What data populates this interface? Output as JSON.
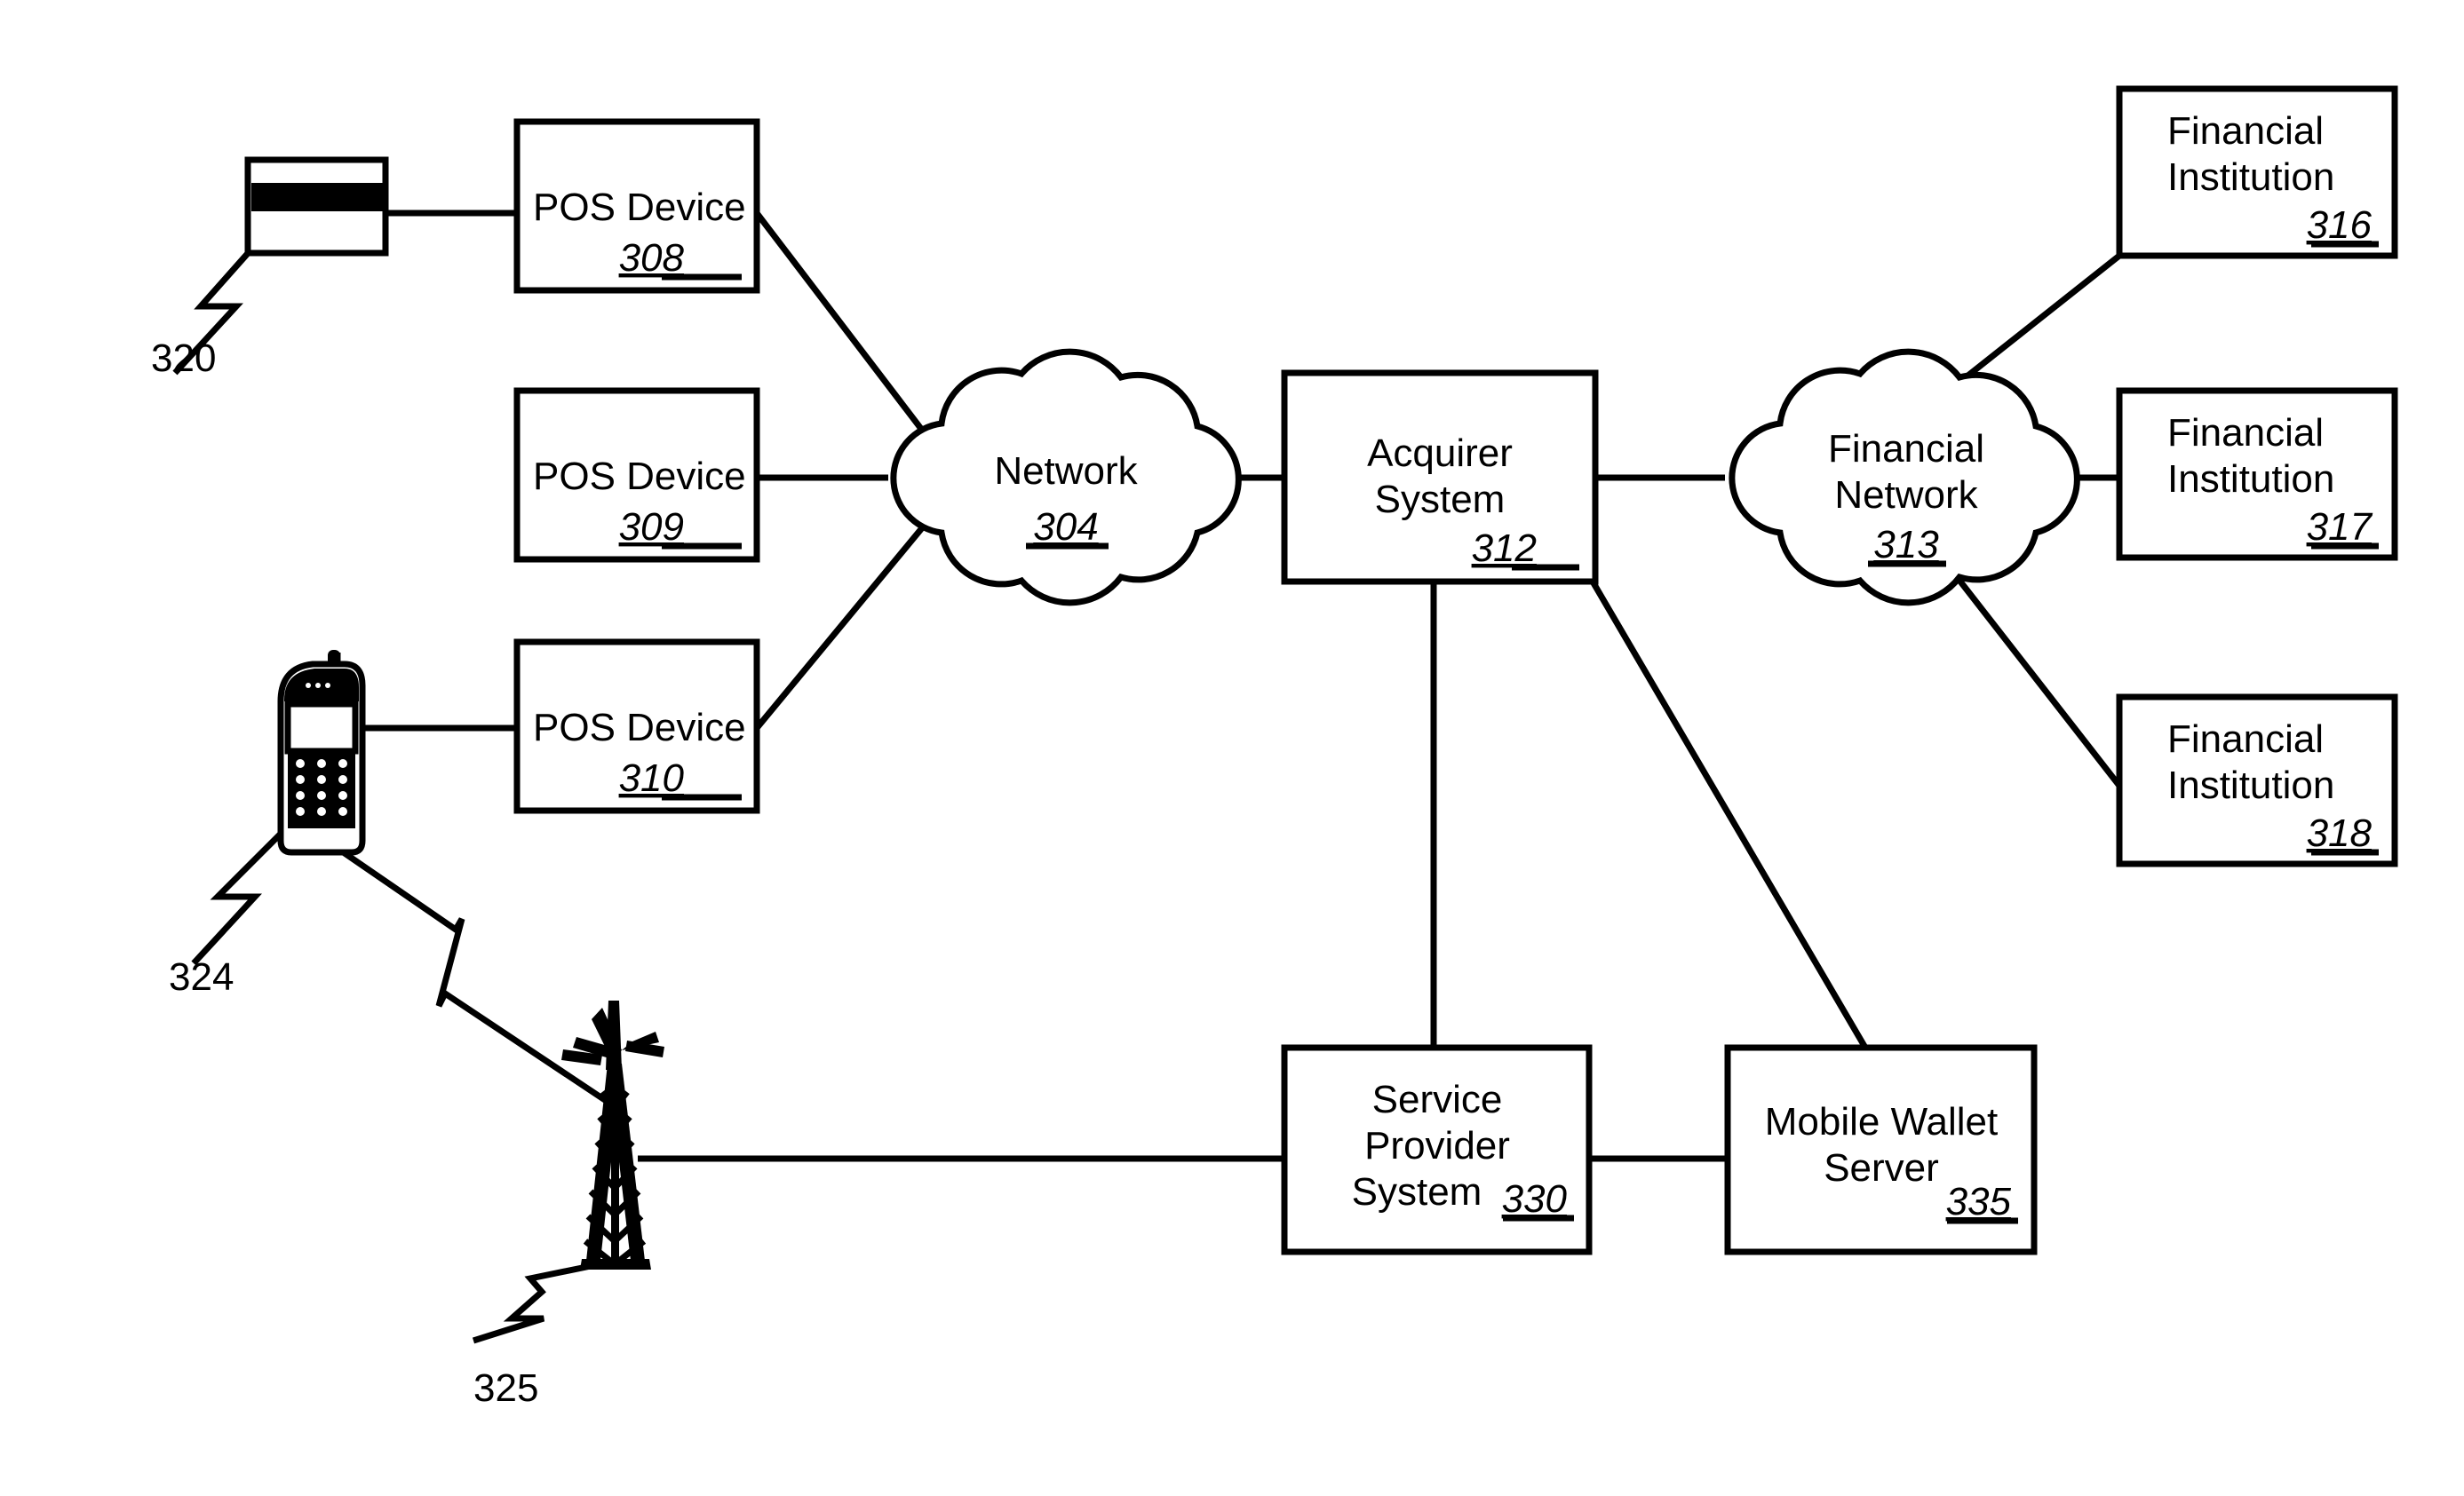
{
  "figure": {
    "title": "Payment Transaction System Block Diagram",
    "background_color": "#ffffff",
    "line_color": "#000000"
  },
  "nodes": {
    "pos_308": {
      "label": "POS Device",
      "ref": "308"
    },
    "pos_309": {
      "label": "POS Device",
      "ref": "309"
    },
    "pos_310": {
      "label": "POS Device",
      "ref": "310"
    },
    "network_304": {
      "label": "Network",
      "ref": "304"
    },
    "acquirer_312": {
      "label_line1": "Acquirer",
      "label_line2": "System",
      "ref": "312"
    },
    "financial_network_313": {
      "label_line1": "Financial",
      "label_line2": "Network",
      "ref": "313"
    },
    "fi_316": {
      "label_line1": "Financial",
      "label_line2": "Institution",
      "ref": "316"
    },
    "fi_317": {
      "label_line1": "Financial",
      "label_line2": "Institution",
      "ref": "317"
    },
    "fi_318": {
      "label_line1": "Financial",
      "label_line2": "Institution",
      "ref": "318"
    },
    "service_provider_330": {
      "label_line1": "Service",
      "label_line2": "Provider",
      "label_line3": "System",
      "ref": "330"
    },
    "mobile_wallet_335": {
      "label_line1": "Mobile Wallet",
      "label_line2": "Server",
      "ref": "335"
    }
  },
  "icons": {
    "payment_card": {
      "name": "payment-card-icon",
      "ref": "320"
    },
    "mobile_phone": {
      "name": "mobile-phone-icon",
      "ref": "324"
    },
    "cell_tower": {
      "name": "cell-tower-icon",
      "ref": "325"
    }
  },
  "reference_labels": {
    "card": "320",
    "phone": "324",
    "tower": "325"
  },
  "connections": [
    {
      "from": "payment_card",
      "to": "pos_308",
      "style": "straight"
    },
    {
      "from": "pos_308",
      "to": "network_304",
      "style": "diagonal"
    },
    {
      "from": "pos_309",
      "to": "network_304",
      "style": "straight"
    },
    {
      "from": "pos_310",
      "to": "network_304",
      "style": "diagonal"
    },
    {
      "from": "mobile_phone",
      "to": "pos_310",
      "style": "straight"
    },
    {
      "from": "mobile_phone",
      "to": "cell_tower",
      "style": "wireless"
    },
    {
      "from": "cell_tower",
      "to": "service_provider_330",
      "style": "straight"
    },
    {
      "from": "network_304",
      "to": "acquirer_312",
      "style": "straight"
    },
    {
      "from": "acquirer_312",
      "to": "financial_network_313",
      "style": "straight"
    },
    {
      "from": "acquirer_312",
      "to": "service_provider_330",
      "style": "vertical"
    },
    {
      "from": "acquirer_312",
      "to": "mobile_wallet_335",
      "style": "diagonal"
    },
    {
      "from": "service_provider_330",
      "to": "mobile_wallet_335",
      "style": "straight"
    },
    {
      "from": "financial_network_313",
      "to": "fi_316",
      "style": "diagonal"
    },
    {
      "from": "financial_network_313",
      "to": "fi_317",
      "style": "straight"
    },
    {
      "from": "financial_network_313",
      "to": "fi_318",
      "style": "diagonal"
    }
  ]
}
